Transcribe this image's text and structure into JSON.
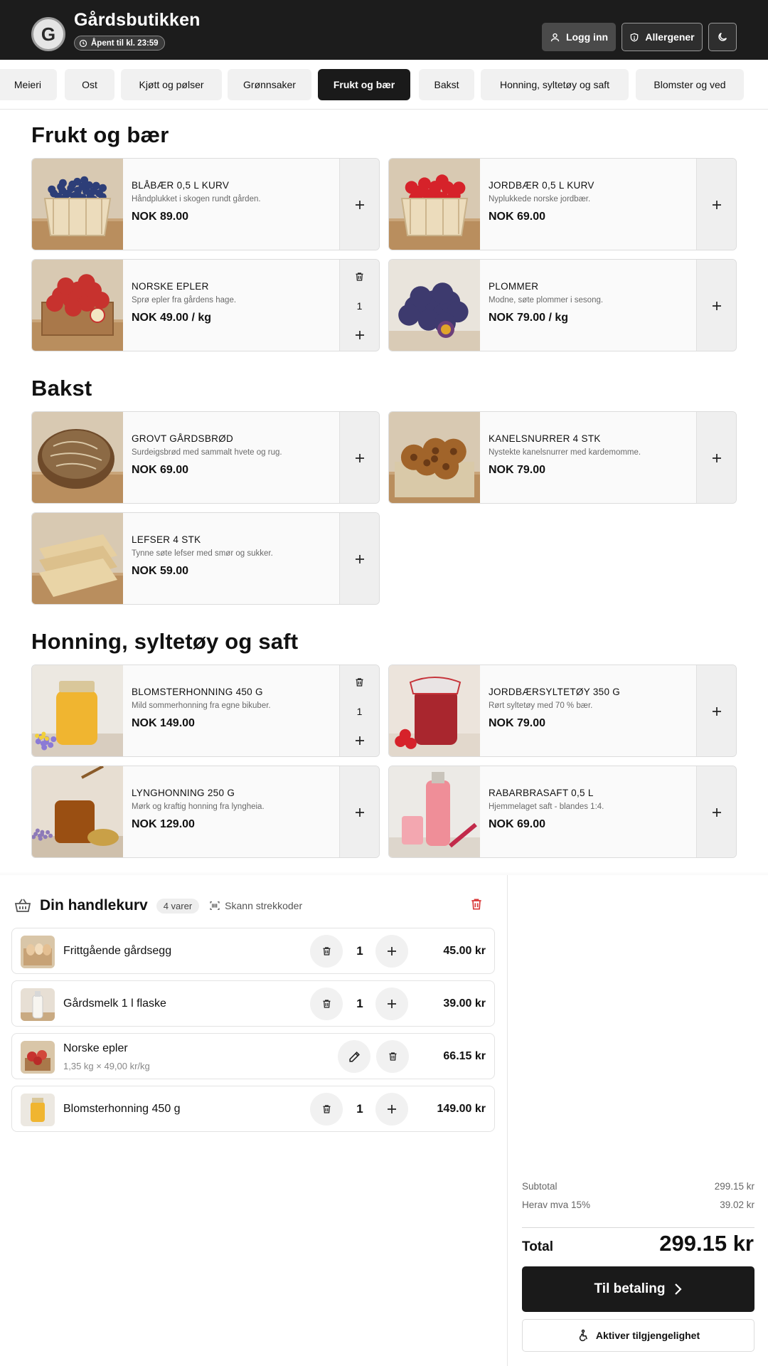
{
  "header": {
    "logo_letter": "G",
    "shop_name": "Gårdsbutikken",
    "open_status": "Åpent til kl. 23:59",
    "login_label": "Logg inn",
    "allergens_label": "Allergener"
  },
  "categories": [
    {
      "label": "Meieri",
      "active": false
    },
    {
      "label": "Ost",
      "active": false
    },
    {
      "label": "Kjøtt og pølser",
      "active": false
    },
    {
      "label": "Grønnsaker",
      "active": false
    },
    {
      "label": "Frukt og bær",
      "active": true
    },
    {
      "label": "Bakst",
      "active": false
    },
    {
      "label": "Honning, syltetøy og saft",
      "active": false
    },
    {
      "label": "Blomster og ved",
      "active": false
    }
  ],
  "sections": [
    {
      "title": "Frukt og bær",
      "products": [
        {
          "name": "BLÅBÆR 0,5 L KURV",
          "desc": "Håndplukket i skogen rundt gården.",
          "price": "NOK 89.00",
          "in_cart_qty": null
        },
        {
          "name": "JORDBÆR 0,5 L KURV",
          "desc": "Nyplukkede norske jordbær.",
          "price": "NOK 69.00",
          "in_cart_qty": null
        },
        {
          "name": "NORSKE EPLER",
          "desc": "Sprø epler fra gårdens hage.",
          "price": "NOK 49.00 / kg",
          "in_cart_qty": "1"
        },
        {
          "name": "PLOMMER",
          "desc": "Modne, søte plommer i sesong.",
          "price": "NOK 79.00 / kg",
          "in_cart_qty": null
        }
      ]
    },
    {
      "title": "Bakst",
      "products": [
        {
          "name": "GROVT GÅRDSBRØD",
          "desc": "Surdeigsbrød med sammalt hvete og rug.",
          "price": "NOK 69.00",
          "in_cart_qty": null
        },
        {
          "name": "KANELSNURRER 4 STK",
          "desc": "Nystekte kanelsnurrer med kardemomme.",
          "price": "NOK 79.00",
          "in_cart_qty": null
        },
        {
          "name": "LEFSER 4 STK",
          "desc": "Tynne søte lefser med smør og sukker.",
          "price": "NOK 59.00",
          "in_cart_qty": null
        }
      ]
    },
    {
      "title": "Honning, syltetøy og saft",
      "products": [
        {
          "name": "BLOMSTERHONNING 450 G",
          "desc": "Mild sommerhonning fra egne bikuber.",
          "price": "NOK 149.00",
          "in_cart_qty": "1"
        },
        {
          "name": "JORDBÆRSYLTETØY 350 G",
          "desc": "Rørt syltetøy med 70 % bær.",
          "price": "NOK 79.00",
          "in_cart_qty": null
        },
        {
          "name": "LYNGHONNING 250 G",
          "desc": "Mørk og kraftig honning fra lyngheia.",
          "price": "NOK 129.00",
          "in_cart_qty": null
        },
        {
          "name": "RABARBRASAFT 0,5 L",
          "desc": "Hjemmelaget saft - blandes 1:4.",
          "price": "NOK 69.00",
          "in_cart_qty": null
        }
      ]
    }
  ],
  "cart": {
    "title": "Din handlekurv",
    "count_label": "4 varer",
    "scan_label": "Skann strekkoder",
    "items": [
      {
        "name": "Frittgående gårdsegg",
        "qty": "1",
        "price": "45.00 kr",
        "detail": null
      },
      {
        "name": "Gårdsmelk 1 l flaske",
        "qty": "1",
        "price": "39.00 kr",
        "detail": null
      },
      {
        "name": "Norske epler",
        "qty": null,
        "price": "66.15 kr",
        "detail": "1,35 kg × 49,00 kr/kg"
      },
      {
        "name": "Blomsterhonning 450 g",
        "qty": "1",
        "price": "149.00 kr",
        "detail": null
      }
    ]
  },
  "summary": {
    "subtotal_label": "Subtotal",
    "subtotal_value": "299.15 kr",
    "vat_label": "Herav mva 15%",
    "vat_value": "39.02 kr",
    "total_label": "Total",
    "total_value": "299.15 kr",
    "checkout_label": "Til betaling",
    "accessibility_label": "Aktiver tilgjengelighet"
  },
  "colors": {
    "header_bg": "#1c1c1c",
    "active_category_bg": "#1a1a1a",
    "danger": "#d93a3a",
    "checkout_bg": "#1a1a1a"
  },
  "icons": {
    "login": "user-icon",
    "allergens": "shield-icon",
    "theme": "moon-icon",
    "open_status": "clock-icon",
    "cart": "basket-icon",
    "scan": "barcode-scan-icon",
    "clear": "trash-icon",
    "add": "plus-icon",
    "edit": "pencil-icon",
    "checkout": "chevron-right-icon",
    "accessibility": "accessibility-icon"
  }
}
